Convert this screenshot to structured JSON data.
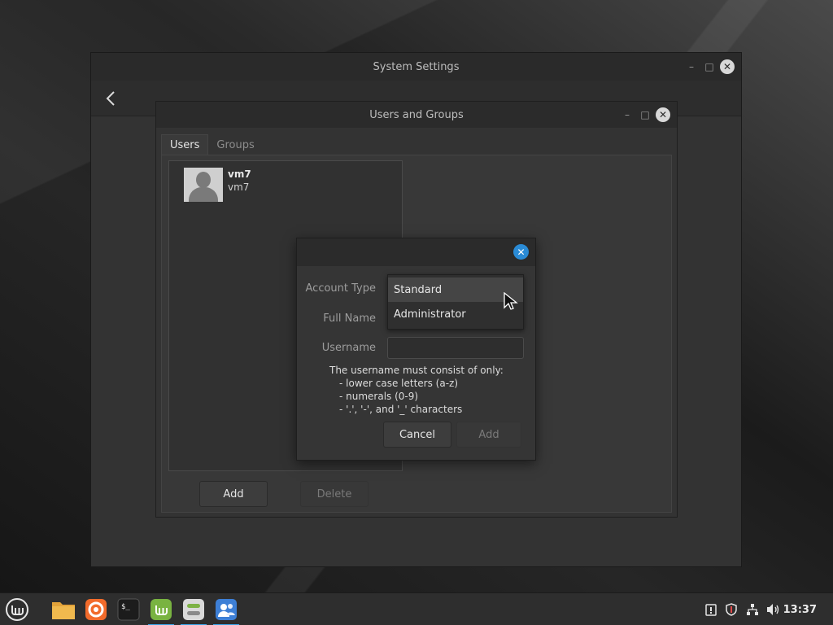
{
  "system_settings": {
    "title": "System Settings",
    "minimize_icon": "minimize-icon",
    "maximize_icon": "maximize-icon",
    "close_icon": "close-icon",
    "back_icon": "chevron-left-icon"
  },
  "users_groups": {
    "title": "Users and Groups",
    "tabs": [
      {
        "label": "Users",
        "active": true
      },
      {
        "label": "Groups",
        "active": false
      }
    ],
    "users": [
      {
        "name": "vm7",
        "login": "vm7",
        "avatar_icon": "user-avatar-icon"
      }
    ],
    "add_label": "Add",
    "delete_label": "Delete"
  },
  "dialog": {
    "close_icon": "close-icon",
    "account_type_label": "Account Type",
    "full_name_label": "Full Name",
    "username_label": "Username",
    "username_value": "",
    "account_type_options": [
      "Standard",
      "Administrator"
    ],
    "highlighted_option": "Standard",
    "hint_title": "The username must consist of only:",
    "hint_lines": [
      "- lower case letters (a-z)",
      "- numerals (0-9)",
      "- '.', '-', and '_' characters"
    ],
    "cancel_label": "Cancel",
    "add_label": "Add"
  },
  "taskbar": {
    "apps": [
      {
        "name": "mint-menu-icon"
      },
      {
        "name": "files-icon"
      },
      {
        "name": "firefox-icon"
      },
      {
        "name": "terminal-icon"
      },
      {
        "name": "mintinstall-icon"
      },
      {
        "name": "system-settings-icon"
      },
      {
        "name": "users-groups-icon"
      }
    ],
    "tray": [
      "update-manager-icon",
      "shield-icon",
      "network-icon",
      "volume-icon"
    ],
    "clock": "13:37",
    "accent_color": "#35a3e8"
  }
}
